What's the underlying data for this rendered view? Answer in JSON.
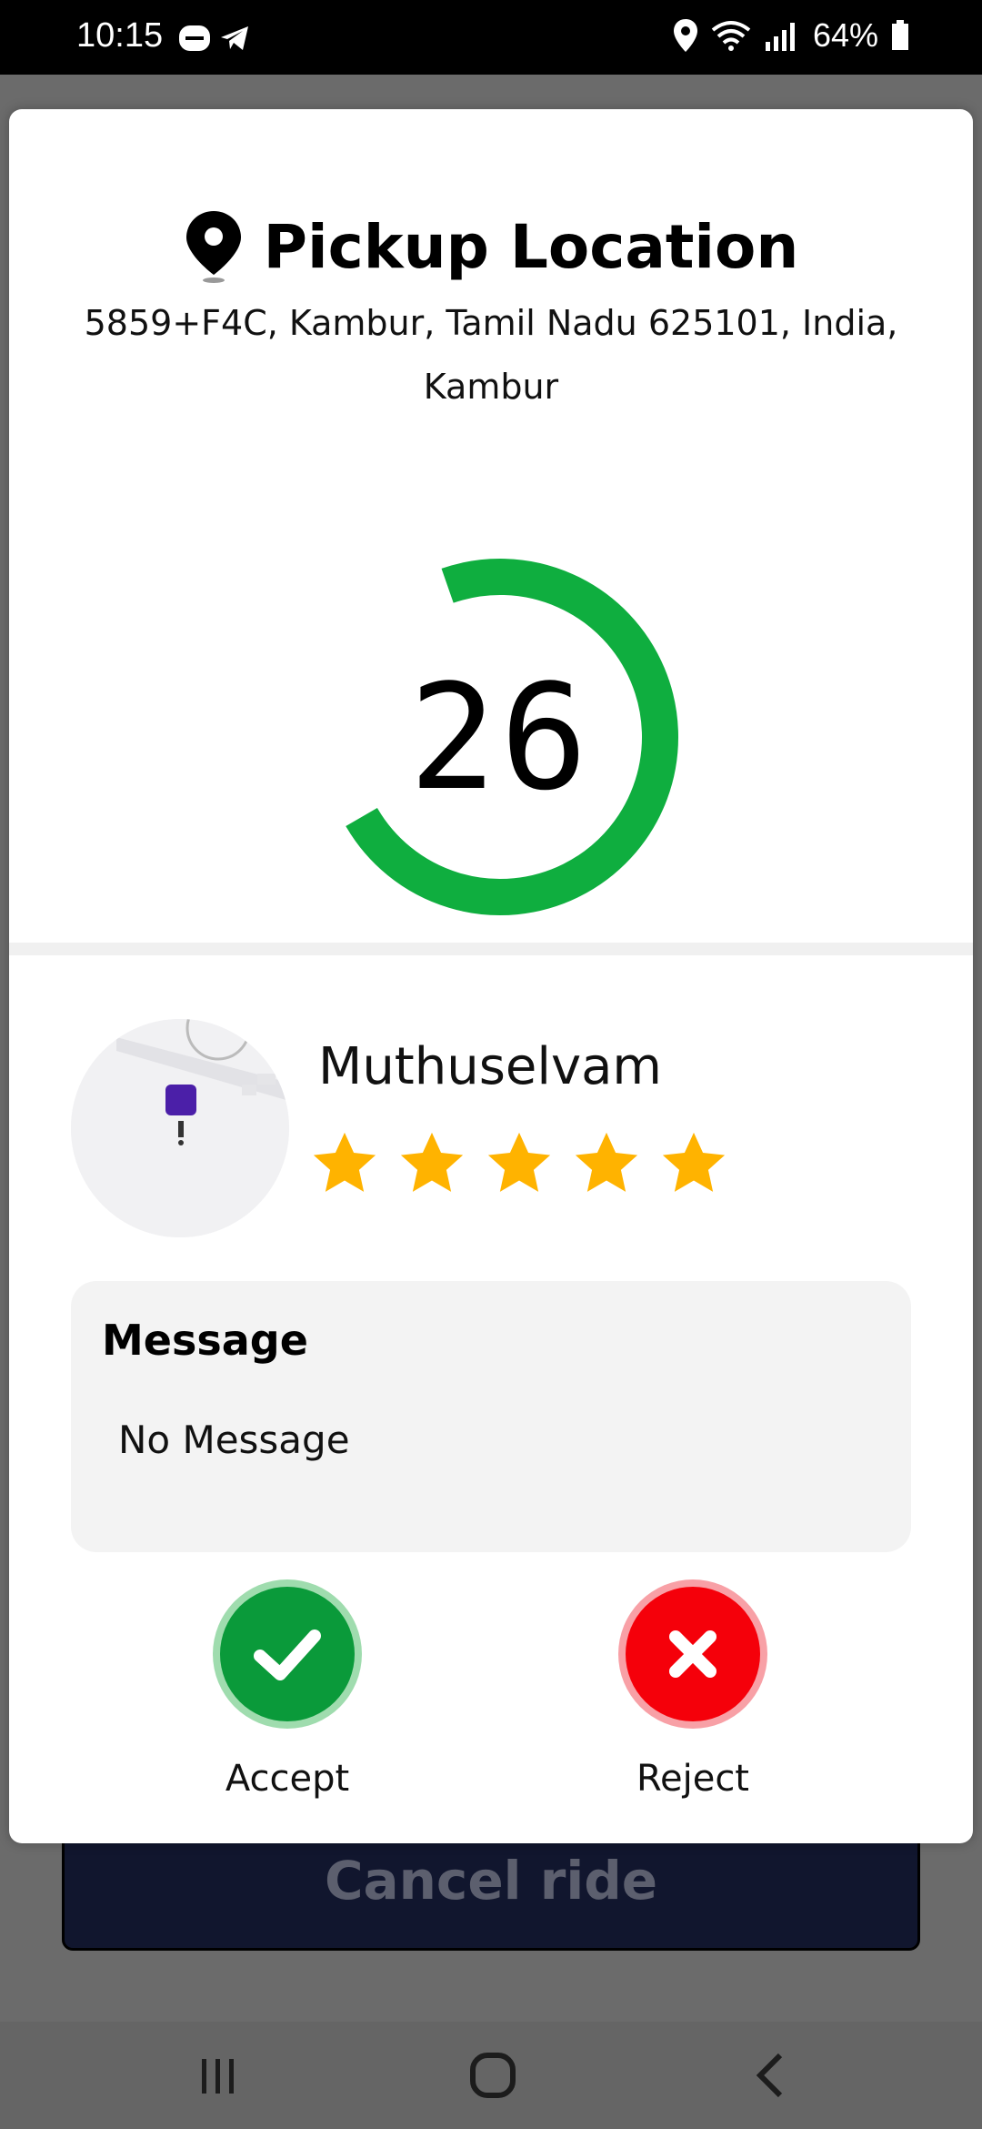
{
  "status_bar": {
    "time": "10:15",
    "battery": "64%",
    "icons": [
      "app-badge-icon",
      "telegram-icon",
      "location-icon",
      "wifi-icon",
      "signal-icon",
      "battery-icon"
    ]
  },
  "pickup": {
    "title": "Pickup Location",
    "address_line1": "5859+F4C, Kambur, Tamil Nadu 625101, India,",
    "address_line2": "Kambur"
  },
  "timer": {
    "value": "26",
    "progress": 0.72,
    "color": "#0fae3f"
  },
  "rider": {
    "name": "Muthuselvam",
    "rating": 5,
    "rating_max": 5,
    "star_color": "#ffb300"
  },
  "message": {
    "title": "Message",
    "text": "No Message"
  },
  "actions": {
    "accept_label": "Accept",
    "reject_label": "Reject",
    "accept_color": "#0a9a3a",
    "reject_color": "#f5000a"
  },
  "background": {
    "cancel_ride_label": "Cancel ride"
  }
}
